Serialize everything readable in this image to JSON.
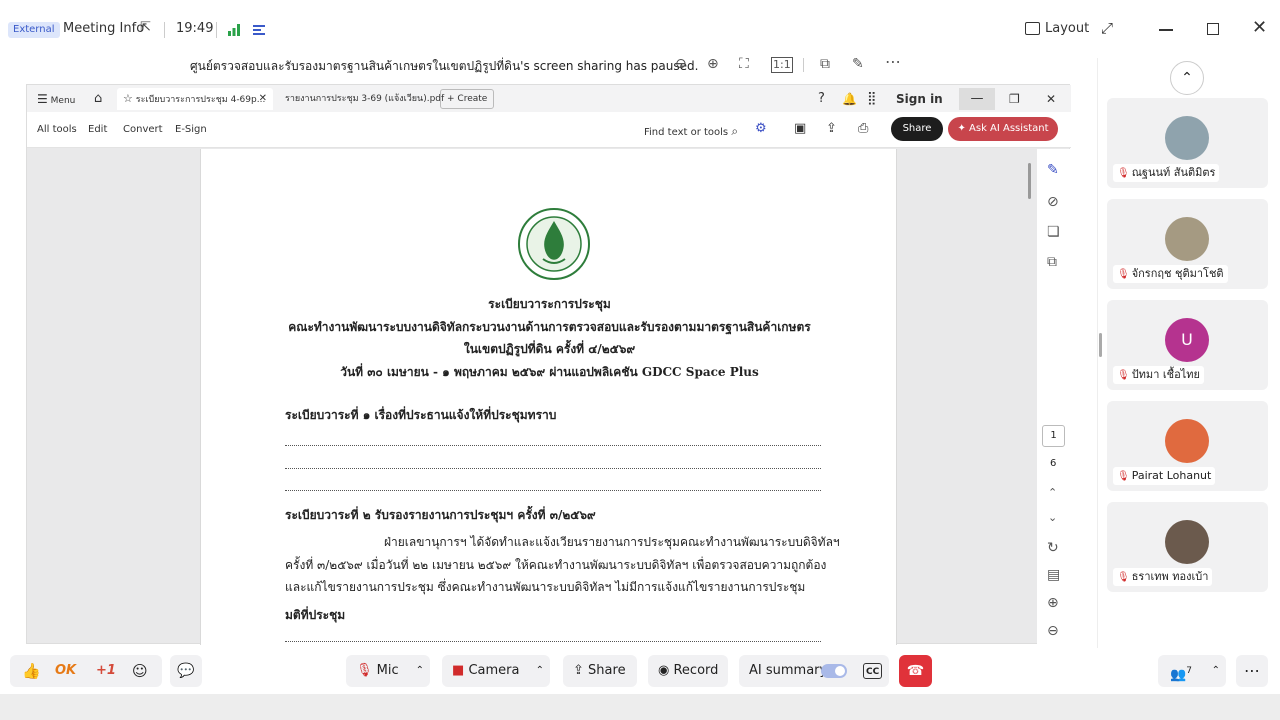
{
  "topbar": {
    "badge": "External",
    "meeting_info": "Meeting Info",
    "time": "19:49",
    "layout": "Layout"
  },
  "share_bar": {
    "message": "ศูนย์ตรวจสอบและรับรองมาตรฐานสินค้าเกษตรในเขตปฏิรูปที่ดิน's screen sharing has paused."
  },
  "acrobat": {
    "menu": "Menu",
    "tabs": [
      "ระเบียบวาระการประชุม 4-69p...",
      "รายงานการประชุม 3-69 (แจ้งเวียน).pdf"
    ],
    "create": "Create",
    "sign_in": "Sign in",
    "tools": [
      "All tools",
      "Edit",
      "Convert",
      "E-Sign"
    ],
    "find": "Find text or tools",
    "share": "Share",
    "ai_assistant": "Ask AI Assistant",
    "page_current": "1",
    "page_total": "6"
  },
  "document": {
    "title": "ระเบียบวาระการประชุม",
    "committee": "คณะทำงานพัฒนาระบบงานดิจิทัลกระบวนงานด้านการตรวจสอบและรับรองตามมาตรฐานสินค้าเกษตร",
    "zone": "ในเขตปฏิรูปที่ดิน ครั้งที่ ๔/๒๕๖๙",
    "date": "วันที่ ๓๐ เมษายน - ๑ พฤษภาคม ๒๕๖๙ ผ่านแอปพลิเคชัน GDCC Space Plus",
    "agenda1": "ระเบียบวาระที่ ๑   เรื่องที่ประธานแจ้งให้ที่ประชุมทราบ",
    "agenda2": "ระเบียบวาระที่ ๒   รับรองรายงานการประชุมฯ ครั้งที่ ๓/๒๕๖๙",
    "para1": "ฝ่ายเลขานุการฯ ได้จัดทำและแจ้งเวียนรายงานการประชุมคณะทำงานพัฒนาระบบดิจิทัลฯ",
    "para2": "ครั้งที่ ๓/๒๕๖๙ เมื่อวันที่ ๒๒ เมษายน ๒๕๖๙ ให้คณะทำงานพัฒนาระบบดิจิทัลฯ เพื่อตรวจสอบความถูกต้อง",
    "para3": "และแก้ไขรายงานการประชุม ซึ่งคณะทำงานพัฒนาระบบดิจิทัลฯ ไม่มีการแจ้งแก้ไขรายงานการประชุม",
    "resolution": "มติที่ประชุม"
  },
  "participants": [
    {
      "name": "ณฐนนท์ สันติมิตร",
      "color": "#8fa3ad"
    },
    {
      "name": "จักรกฤช ชุติมาโชติ",
      "color": "#a59a82"
    },
    {
      "name": "ปัทมา เชื้อไทย",
      "initial": "U",
      "color": "#b5338f"
    },
    {
      "name": "Pairat Lohanut",
      "color": "#e06a3f"
    },
    {
      "name": "ธราเทพ ทองเบ้า",
      "color": "#6b5a4d"
    }
  ],
  "controls": {
    "ok": "OK",
    "plus_one": "+1",
    "mic": "Mic",
    "camera": "Camera",
    "share": "Share",
    "record": "Record",
    "ai_summary": "AI summary",
    "cc": "CC",
    "participant_count": "7"
  }
}
